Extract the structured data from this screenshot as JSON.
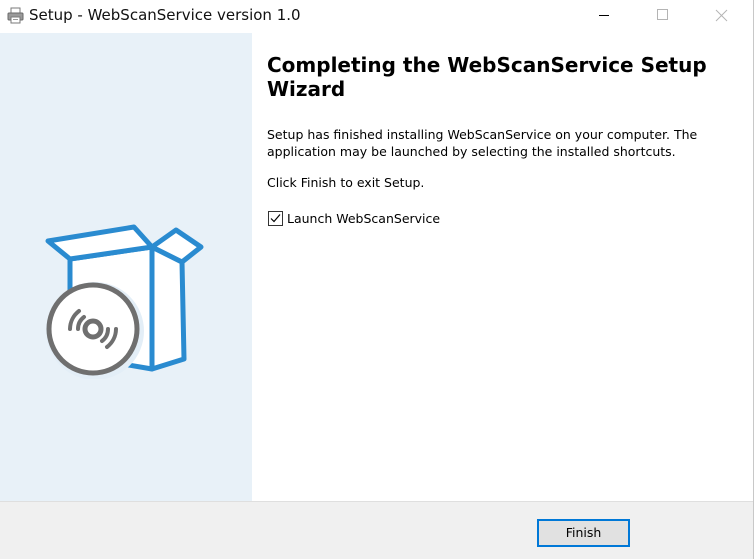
{
  "window": {
    "title": "Setup - WebScanService version 1.0",
    "icon": "printer-icon"
  },
  "caption_buttons": {
    "minimize_icon": "minimize-icon",
    "maximize_icon": "maximize-icon",
    "close_icon": "close-icon"
  },
  "banner": {
    "graphic": "software-box-with-disc-icon",
    "background_color": "#e8f1f8",
    "accent_color": "#2a8bd0"
  },
  "content": {
    "heading": "Completing the WebScanService Setup Wizard",
    "description": "Setup has finished installing WebScanService on your computer. The application may be launched by selecting the installed shortcuts.",
    "finish_note": "Click Finish to exit Setup.",
    "launch_checkbox": {
      "label": "Launch WebScanService",
      "checked": true
    }
  },
  "footer": {
    "finish_label": "Finish",
    "focus_color": "#0078d7"
  }
}
